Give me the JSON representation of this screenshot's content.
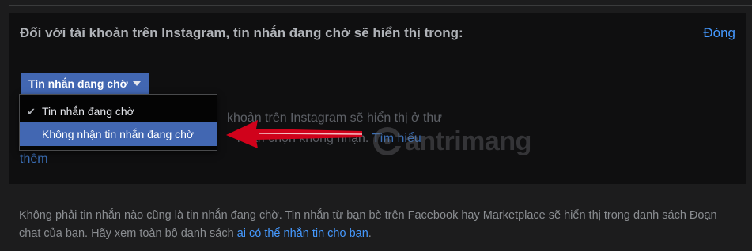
{
  "panel": {
    "title": "Đối với tài khoản trên Instagram, tin nhắn đang chờ sẽ hiển thị trong:",
    "close_label": "Đóng",
    "select": {
      "selected_value": "Tin nhắn đang chờ",
      "caret_icon": "caret-down-icon"
    },
    "description": {
      "line1": "khoản trên Instagram sẽ hiển thị ở thư",
      "line2_part": "i bạn chọn không nhận.",
      "link_part1": "Tìm hiểu",
      "link_part2": "thêm"
    },
    "menu": {
      "items": [
        {
          "label": "Tin nhắn đang chờ",
          "checked": true
        },
        {
          "label": "Không nhận tin nhắn đang chờ",
          "checked": false,
          "highlighted": true
        }
      ],
      "check_icon": "checkmark-icon"
    }
  },
  "watermark": {
    "text": "antrimang",
    "icon": "cantrimang-logo-icon"
  },
  "annotation": {
    "icon": "red-arrow-icon",
    "color": "#d0021b"
  },
  "footer": {
    "text": "Không phải tin nhắn nào cũng là tin nhắn đang chờ. Tin nhắn từ bạn bè trên Facebook hay Marketplace sẽ hiển thị trong danh sách Đoạn chat của bạn. Hãy xem toàn bộ danh sách ",
    "link": "ai có thể nhắn tin cho bạn",
    "end": "."
  }
}
